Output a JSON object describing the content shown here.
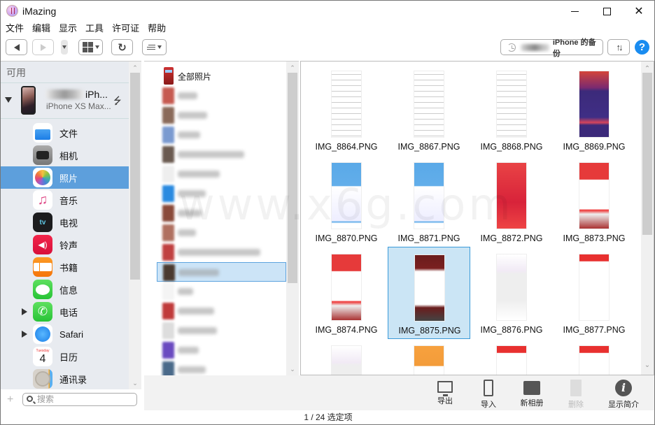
{
  "window": {
    "title": "iMazing",
    "controls": {
      "minimize": "minimize",
      "maximize": "maximize",
      "close": "close"
    }
  },
  "menu": [
    "文件",
    "编辑",
    "显示",
    "工具",
    "许可证",
    "帮助"
  ],
  "toolbar": {
    "back_icon": "triangle-left",
    "forward_icon": "triangle-right",
    "backup_label": "iPhone 的备份",
    "sort_label": "↑↓",
    "help_label": "?"
  },
  "sidebar": {
    "header": "可用",
    "device": {
      "name": "iPh...",
      "model": "iPhone XS Max..."
    },
    "items": [
      {
        "label": "文件",
        "icon": "files"
      },
      {
        "label": "相机",
        "icon": "camera"
      },
      {
        "label": "照片",
        "icon": "photos",
        "selected": true
      },
      {
        "label": "音乐",
        "icon": "music",
        "glyph": "♫"
      },
      {
        "label": "电视",
        "icon": "tv",
        "glyph": "tv"
      },
      {
        "label": "铃声",
        "icon": "ringtones",
        "glyph": "◀)"
      },
      {
        "label": "书籍",
        "icon": "books"
      },
      {
        "label": "信息",
        "icon": "messages"
      },
      {
        "label": "电话",
        "icon": "phone",
        "glyph": "✆",
        "expandable": true
      },
      {
        "label": "Safari",
        "icon": "safari",
        "expandable": true
      },
      {
        "label": "日历",
        "icon": "calendar",
        "day_name": "Tuesday",
        "day": "4"
      },
      {
        "label": "通讯录",
        "icon": "contacts"
      }
    ],
    "search_placeholder": "搜索",
    "add_label": "+"
  },
  "albums": {
    "first": "全部照片",
    "blurred_count": 15,
    "selected_index": 9
  },
  "photos": [
    {
      "name": "IMG_8864.PNG"
    },
    {
      "name": "IMG_8867.PNG"
    },
    {
      "name": "IMG_8868.PNG"
    },
    {
      "name": "IMG_8869.PNG"
    },
    {
      "name": "IMG_8870.PNG"
    },
    {
      "name": "IMG_8871.PNG"
    },
    {
      "name": "IMG_8872.PNG"
    },
    {
      "name": "IMG_8873.PNG"
    },
    {
      "name": "IMG_8874.PNG"
    },
    {
      "name": "IMG_8875.PNG",
      "selected": true
    },
    {
      "name": "IMG_8876.PNG"
    },
    {
      "name": "IMG_8877.PNG"
    },
    {
      "name": ""
    },
    {
      "name": ""
    },
    {
      "name": ""
    },
    {
      "name": ""
    }
  ],
  "actions": [
    {
      "label": "导出",
      "icon": "export"
    },
    {
      "label": "导入",
      "icon": "import"
    },
    {
      "label": "新相册",
      "icon": "new-album"
    },
    {
      "label": "删除",
      "icon": "delete",
      "disabled": true
    },
    {
      "label": "显示简介",
      "icon": "info"
    }
  ],
  "status": "1 / 24 选定项",
  "watermark": "www.x6g.com"
}
